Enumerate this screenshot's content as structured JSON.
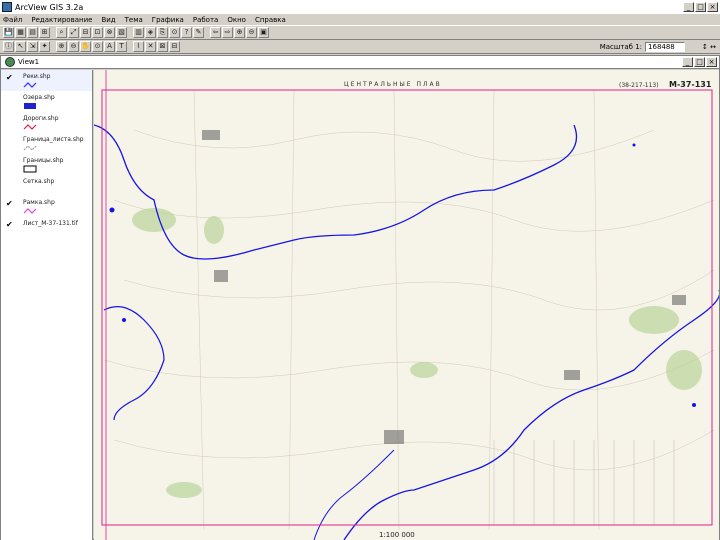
{
  "window": {
    "title": "ArcView GIS 3.2a",
    "controls": [
      "_",
      "□",
      "×"
    ]
  },
  "menubar": {
    "items": [
      "Файл",
      "Редактирование",
      "Вид",
      "Тема",
      "Графика",
      "Работа",
      "Окно",
      "Справка"
    ]
  },
  "toolbar1": {
    "buttons": [
      "💾",
      "▦",
      "▤",
      "⊞",
      "⌕",
      "⤢",
      "⊟",
      "⊡",
      "⊗",
      "▧",
      "▥",
      "◈",
      "⎘",
      "⊙",
      "?",
      "✎",
      "⇦",
      "⇨",
      "⊕",
      "⊖",
      "▣"
    ]
  },
  "toolbar2": {
    "buttons": [
      "ⓘ",
      "↖",
      "⇲",
      "✦",
      "⊕",
      "⊖",
      "✋",
      "⊙",
      "A",
      "T",
      "⌇",
      "✕",
      "⊠",
      "⊟"
    ]
  },
  "scale": {
    "label": "Масштаб 1:",
    "value": "168488",
    "dimension": "↕ ↔"
  },
  "view": {
    "title": "View1",
    "controls": [
      "_",
      "□",
      "×"
    ]
  },
  "toc": {
    "themes": [
      {
        "name": "Реки.shp",
        "checked": true,
        "symbol": "line",
        "color": "#2d2dff"
      },
      {
        "name": "Озера.shp",
        "checked": false,
        "symbol": "fill",
        "color": "#1e22c8"
      },
      {
        "name": "Дороги.shp",
        "checked": false,
        "symbol": "line",
        "color": "#e0204c"
      },
      {
        "name": "Граница_листа.shp",
        "checked": false,
        "symbol": "dash",
        "color": "#a0a0a0"
      },
      {
        "name": "Границы.shp",
        "checked": false,
        "symbol": "box",
        "color": "#000000"
      },
      {
        "name": "Сетка.shp",
        "checked": false,
        "symbol": "none",
        "color": "#808080"
      },
      {
        "name": "Рамка.shp",
        "checked": true,
        "symbol": "line",
        "color": "#e040e0"
      },
      {
        "name": "Лист_М-37-131.tif",
        "checked": true,
        "symbol": "none",
        "color": "#808080"
      }
    ]
  },
  "map": {
    "sheet_title": "ЦЕНТРАЛЬНЫЕ ПЛАВ",
    "sheet_code": "M-37-131",
    "sheet_ref": "(38-217-113)",
    "scale_text": "1:100 000",
    "river_color": "#1414e6",
    "frame_color": "#e0208c"
  }
}
